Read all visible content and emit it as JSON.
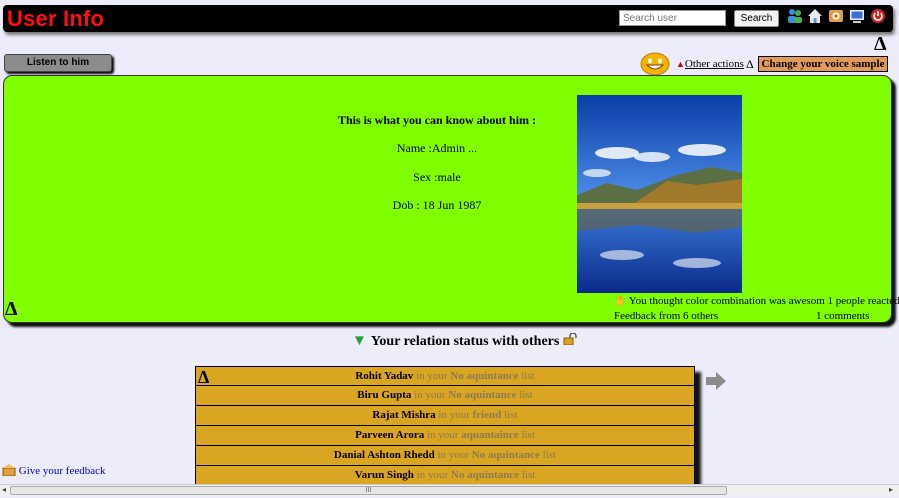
{
  "header": {
    "title": "User Info",
    "search_placeholder": "Search user",
    "search_button": "Search",
    "icons": [
      "users-icon",
      "home-icon",
      "settings-icon",
      "monitor-icon",
      "power-icon"
    ]
  },
  "toggle_symbol": "Δ",
  "toolbar": {
    "listen_label": "Listen to him",
    "other_actions_marker": "▲",
    "other_actions_label": "Other actions",
    "change_voice_label": "Change your voice sample"
  },
  "profile": {
    "heading": "This is what you can know about him :",
    "name_line": "Name :Admin ...",
    "sex_line": "Sex :male",
    "dob_line": "Dob : 18 Jun 1987",
    "reaction_text": "You thought color combination was awesom 1 people reacted",
    "feedback_text": "Feedback from 6 others",
    "comments_text": "1 comments"
  },
  "relations": {
    "title": "Your relation status with others",
    "in_your": "in your",
    "list_word": "list",
    "items": [
      {
        "name": "Rohit Yadav",
        "kind": "No aquintance"
      },
      {
        "name": "Biru Gupta",
        "kind": "No aquintance"
      },
      {
        "name": "Rajat Mishra",
        "kind": "friend"
      },
      {
        "name": "Parveen Arora",
        "kind": "aquantaince"
      },
      {
        "name": "Danial Ashton Rhedd",
        "kind": "No aquintance"
      },
      {
        "name": "Varun Singh",
        "kind": "No aquintance"
      }
    ]
  },
  "footer": {
    "feedback_link": "Give your feedback",
    "scroll_grip": "III"
  },
  "colors": {
    "title_red": "#ff1010",
    "panel_green": "#7fff00",
    "relation_gold": "#daa520",
    "voice_orange": "#e29a5a"
  }
}
